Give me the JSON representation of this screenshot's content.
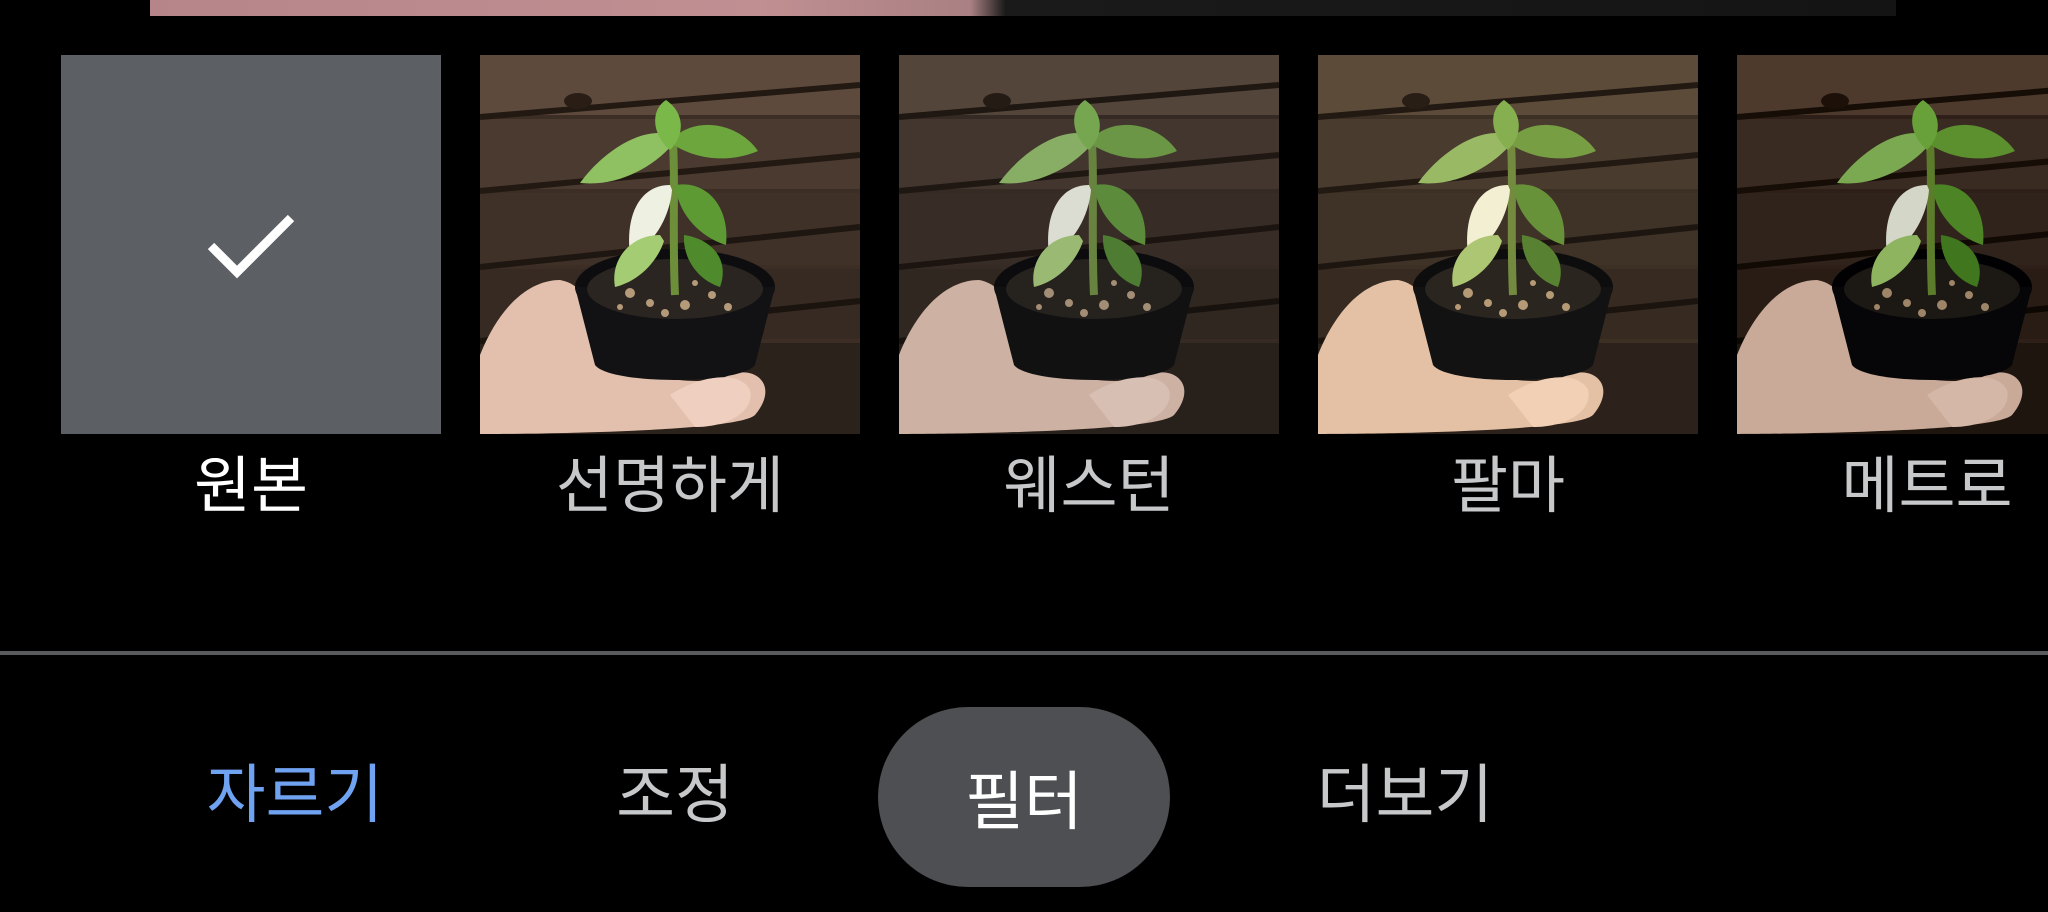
{
  "filters": {
    "items": [
      {
        "label": "원본",
        "selected": true
      },
      {
        "label": "선명하게",
        "selected": false
      },
      {
        "label": "웨스턴",
        "selected": false
      },
      {
        "label": "팔마",
        "selected": false
      },
      {
        "label": "메트로",
        "selected": false
      }
    ],
    "selected_icon": "check-icon"
  },
  "tabs": {
    "crop": "자르기",
    "adjust": "조정",
    "filter": "필터",
    "more": "더보기",
    "active": "필터"
  },
  "colors": {
    "background": "#000000",
    "accent_blue": "#6fa3f2",
    "active_pill": "#4e4f52",
    "selected_tile": "#5c5f63"
  }
}
